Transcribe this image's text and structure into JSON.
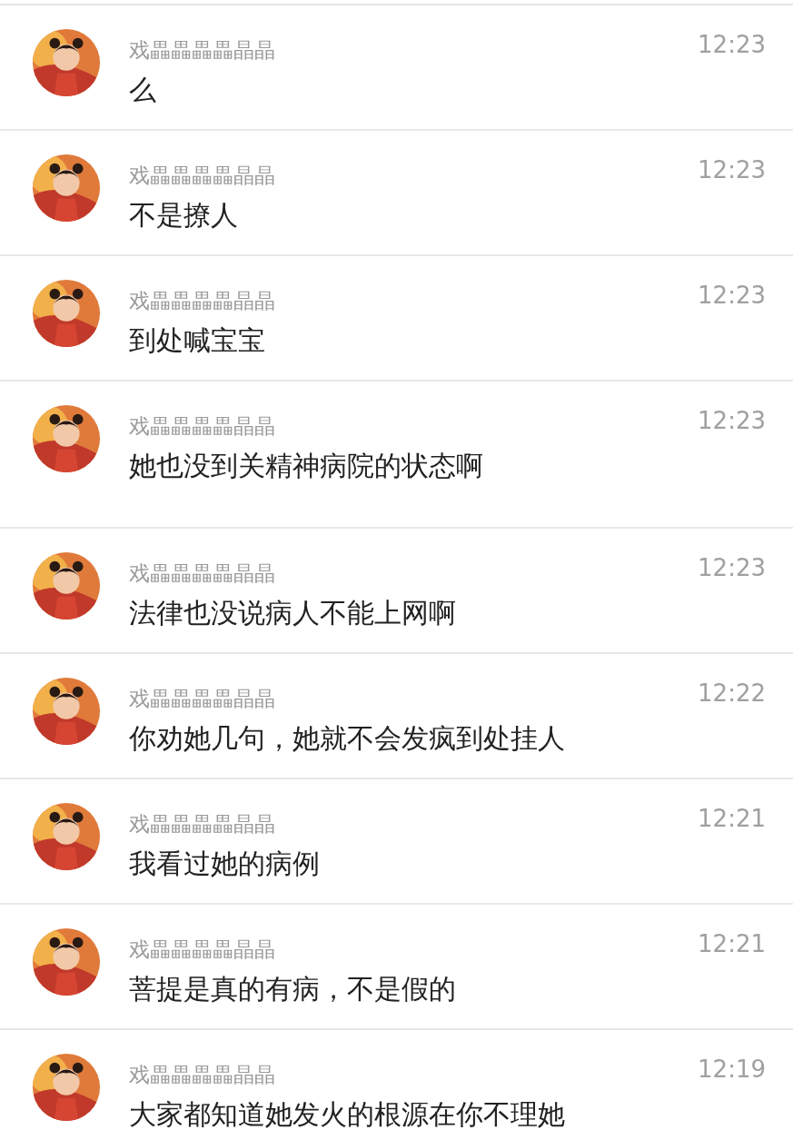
{
  "messages": [
    {
      "name": "戏畾畾畾畾晶晶",
      "time": "12:23",
      "text": "么"
    },
    {
      "name": "戏畾畾畾畾晶晶",
      "time": "12:23",
      "text": "不是撩人"
    },
    {
      "name": "戏畾畾畾畾晶晶",
      "time": "12:23",
      "text": "到处喊宝宝"
    },
    {
      "name": "戏畾畾畾畾晶晶",
      "time": "12:23",
      "text": "她也没到关精神病院的状态啊"
    },
    {
      "name": "戏畾畾畾畾晶晶",
      "time": "12:23",
      "text": "法律也没说病人不能上网啊"
    },
    {
      "name": "戏畾畾畾畾晶晶",
      "time": "12:22",
      "text": "你劝她几句，她就不会发疯到处挂人"
    },
    {
      "name": "戏畾畾畾畾晶晶",
      "time": "12:21",
      "text": "我看过她的病例"
    },
    {
      "name": "戏畾畾畾畾晶晶",
      "time": "12:21",
      "text": "菩提是真的有病，不是假的"
    },
    {
      "name": "戏畾畾畾畾晶晶",
      "time": "12:19",
      "text": "大家都知道她发火的根源在你不理她"
    }
  ]
}
